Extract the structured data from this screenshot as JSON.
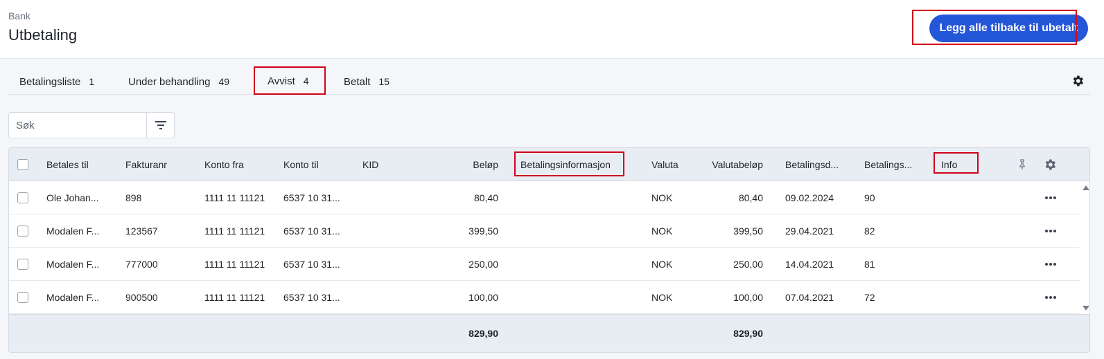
{
  "header": {
    "breadcrumb": "Bank",
    "title": "Utbetaling",
    "primary_button": "Legg alle tilbake til ubetalt"
  },
  "tabs": [
    {
      "label": "Betalingsliste",
      "count": "1"
    },
    {
      "label": "Under behandling",
      "count": "49"
    },
    {
      "label": "Avvist",
      "count": "4",
      "active": true
    },
    {
      "label": "Betalt",
      "count": "15"
    }
  ],
  "search": {
    "placeholder": "Søk",
    "value": ""
  },
  "table": {
    "columns": [
      "Betales til",
      "Fakturanr",
      "Konto fra",
      "Konto til",
      "KID",
      "Beløp",
      "Betalingsinformasjon",
      "Valuta",
      "Valutabeløp",
      "Betalingsd...",
      "Betalings...",
      "Info"
    ],
    "rows": [
      {
        "betales_til": "Ole Johan...",
        "fakturanr": "898",
        "konto_fra": "1111 11 11121",
        "konto_til": "6537 10 31...",
        "kid": "",
        "belop": "80,40",
        "betalingsinformasjon": "",
        "valuta": "NOK",
        "valutabelop": "80,40",
        "betalingsdato": "09.02.2024",
        "betalings": "90",
        "info": ""
      },
      {
        "betales_til": "Modalen F...",
        "fakturanr": "123567",
        "konto_fra": "1111 11 11121",
        "konto_til": "6537 10 31...",
        "kid": "",
        "belop": "399,50",
        "betalingsinformasjon": "",
        "valuta": "NOK",
        "valutabelop": "399,50",
        "betalingsdato": "29.04.2021",
        "betalings": "82",
        "info": ""
      },
      {
        "betales_til": "Modalen F...",
        "fakturanr": "777000",
        "konto_fra": "1111 11 11121",
        "konto_til": "6537 10 31...",
        "kid": "",
        "belop": "250,00",
        "betalingsinformasjon": "",
        "valuta": "NOK",
        "valutabelop": "250,00",
        "betalingsdato": "14.04.2021",
        "betalings": "81",
        "info": ""
      },
      {
        "betales_til": "Modalen F...",
        "fakturanr": "900500",
        "konto_fra": "1111 11 11121",
        "konto_til": "6537 10 31...",
        "kid": "",
        "belop": "100,00",
        "betalingsinformasjon": "",
        "valuta": "NOK",
        "valutabelop": "100,00",
        "betalingsdato": "07.04.2021",
        "betalings": "72",
        "info": ""
      }
    ],
    "totals": {
      "belop": "829,90",
      "valutabelop": "829,90"
    }
  },
  "colors": {
    "primary": "#2456d8",
    "highlight": "#d0021b",
    "header_bg": "#e8edf4"
  },
  "icons": {
    "tab_settings": "gear-icon",
    "filter": "filter-icon",
    "column_settings": "gear-icon",
    "pin": "pin-icon",
    "row_menu": "more-horizontal-icon"
  }
}
